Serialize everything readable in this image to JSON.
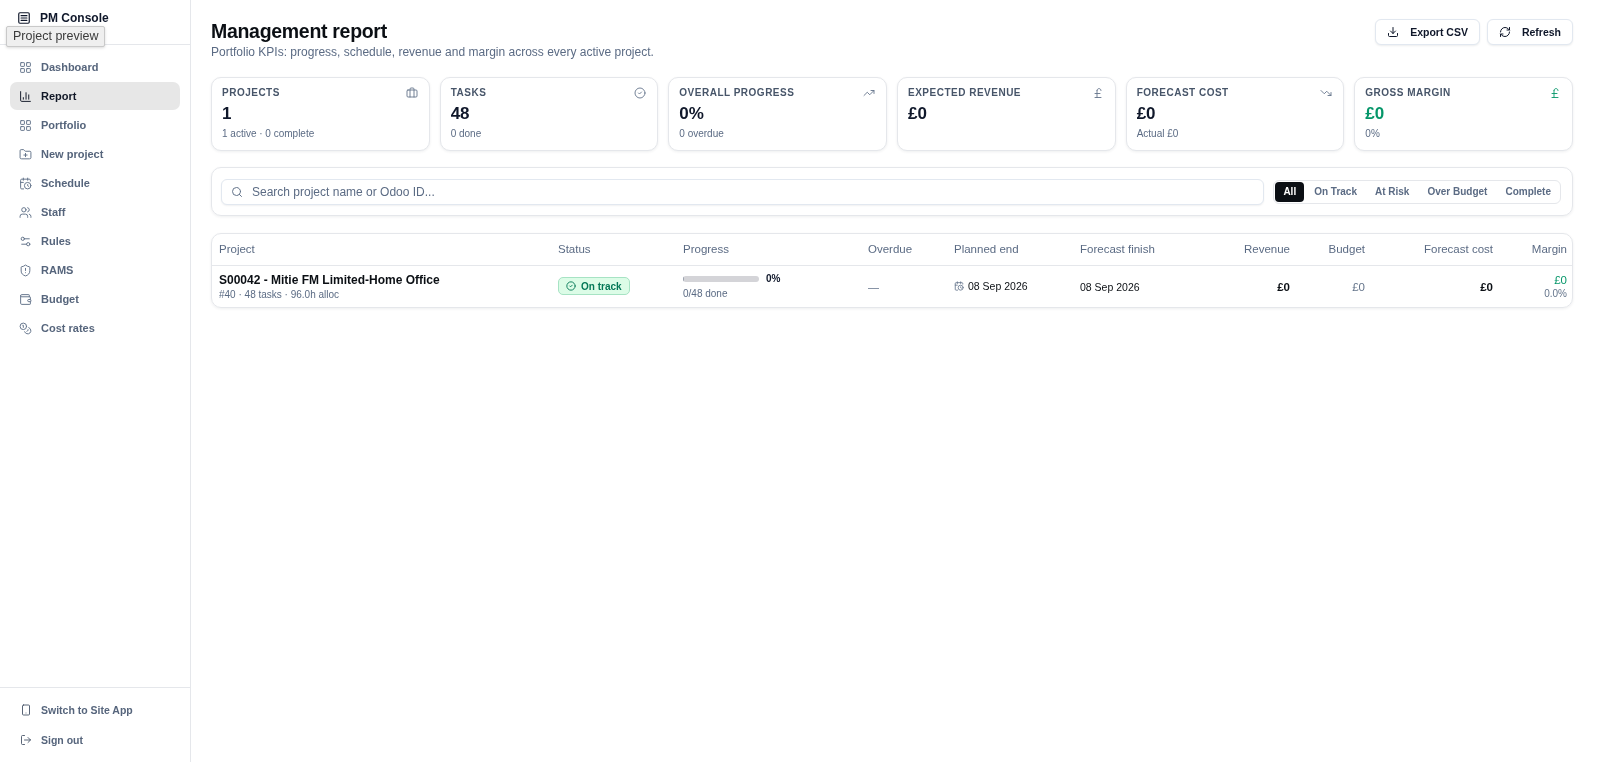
{
  "sidebar": {
    "brand": "PM Console",
    "tooltip": "Project preview",
    "items": [
      {
        "label": "Dashboard",
        "selected": false
      },
      {
        "label": "Report",
        "selected": true
      },
      {
        "label": "Portfolio",
        "selected": false
      },
      {
        "label": "New project",
        "selected": false
      },
      {
        "label": "Schedule",
        "selected": false
      },
      {
        "label": "Staff",
        "selected": false
      },
      {
        "label": "Rules",
        "selected": false
      },
      {
        "label": "RAMS",
        "selected": false
      },
      {
        "label": "Budget",
        "selected": false
      },
      {
        "label": "Cost rates",
        "selected": false
      }
    ],
    "footer_items": [
      "Switch to Site App",
      "Sign out"
    ]
  },
  "header": {
    "title": "Management report",
    "subtitle": "Portfolio KPIs: progress, schedule, revenue and margin across every active project.",
    "buttons": [
      "Export CSV",
      "Refresh"
    ]
  },
  "kpis": [
    {
      "label": "PROJECTS",
      "value": "1",
      "note": "1 active · 0 complete",
      "positive": false
    },
    {
      "label": "TASKS",
      "value": "48",
      "note": "0 done",
      "positive": false
    },
    {
      "label": "OVERALL PROGRESS",
      "value": "0%",
      "note": "0 overdue",
      "positive": false
    },
    {
      "label": "EXPECTED REVENUE",
      "value": "£0",
      "positive": false
    },
    {
      "label": "FORECAST COST",
      "value": "£0",
      "note": "Actual £0",
      "positive": false
    },
    {
      "label": "GROSS MARGIN",
      "value": "£0",
      "note": "0%",
      "positive": true
    }
  ],
  "filter_bar": {
    "search": {
      "placeholder": "Search project name or Odoo ID..."
    },
    "filters": [
      {
        "label": "All",
        "selected": true
      },
      {
        "label": "On Track",
        "selected": false
      },
      {
        "label": "At Risk",
        "selected": false
      },
      {
        "label": "Over Budget",
        "selected": false
      },
      {
        "label": "Complete",
        "selected": false
      }
    ]
  },
  "table": {
    "columns": [
      "Project",
      "Status",
      "Progress",
      "Overdue",
      "Planned end",
      "Forecast finish",
      "Revenue",
      "Budget",
      "Forecast cost",
      "Margin"
    ],
    "rows": [
      {
        "project": "S00042 - Mitie FM Limited-Home Office",
        "meta": "#40 · 48 tasks · 96.0h alloc",
        "status": {
          "label": "On track",
          "kind": "on_track"
        },
        "progress": {
          "level": 0,
          "percent": "0%",
          "done": "0/48 done"
        },
        "overdue": "—",
        "planned_end": "08 Sep 2026",
        "forecast_finish": "08 Sep 2026",
        "revenue": "£0",
        "budget": "£0",
        "forecast_cost": "£0",
        "margin": {
          "value": "£0",
          "percent": "0.0%",
          "positive": true
        }
      }
    ]
  }
}
